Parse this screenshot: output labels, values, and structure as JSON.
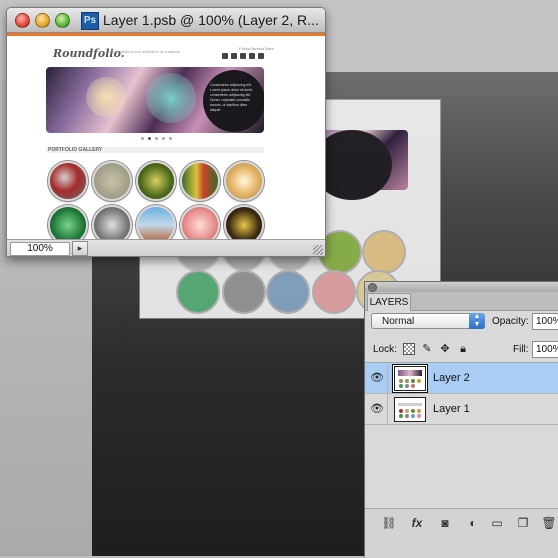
{
  "document_window": {
    "title": "Layer 1.psb @ 100% (Layer 2, R...",
    "app_icon": "Ps",
    "zoom": "100%"
  },
  "canvas_content": {
    "logo": "Roundfolio.",
    "tagline": "Roundfolio is the exhibition of creativity",
    "follow_text": "Follow Behind Bars",
    "banner_text": "Consectetur adipiscing elit. Lorem ipsum dolor sit amet, consectetur adipiscing elit. Donec vulputate convallis mauris, ut dapibus diam aliquet.",
    "gallery_label": "PORTFOLIO GALLERY"
  },
  "layers_panel": {
    "tab": "LAYERS",
    "blend_mode": "Normal",
    "opacity_label": "Opacity:",
    "opacity_value": "100%",
    "lock_label": "Lock:",
    "fill_label": "Fill:",
    "fill_value": "100%",
    "layers": [
      {
        "name": "Layer 2",
        "selected": true,
        "visible": true
      },
      {
        "name": "Layer 1",
        "selected": false,
        "visible": true
      }
    ]
  },
  "colors": {
    "accent": "#ee7722",
    "selection": "#a9cdf3"
  }
}
